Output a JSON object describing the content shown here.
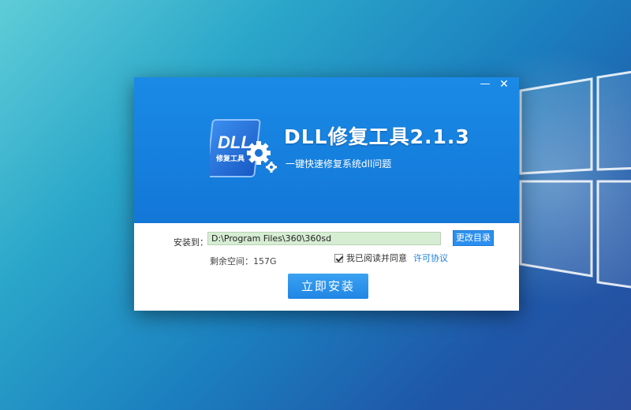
{
  "window": {
    "minimize_glyph": "—",
    "close_glyph": "✕"
  },
  "hero": {
    "logo_text": "DLL",
    "logo_subtext": "修复工具",
    "title": "DLL修复工具2.1.3",
    "subtitle": "一键快速修复系统dll问题"
  },
  "install": {
    "path_label": "安装到：",
    "path_value": "D:\\Program Files\\360\\360sd",
    "browse_label": "更改目录",
    "space_label": "剩余空间：157G",
    "agree_checked": true,
    "agree_text": "我已阅读并同意",
    "license_link": "许可协议",
    "install_button": "立即安装"
  },
  "icons": {
    "desktop_logo": "windows-logo-icon",
    "app_logo": "dll-gear-icon",
    "minimize": "minimize-icon",
    "close": "close-icon",
    "checkbox": "checkbox-checked-icon"
  },
  "colors": {
    "hero_blue": "#1377d8",
    "button_blue": "#2b8ff0",
    "path_bg": "#d6edd3",
    "link_blue": "#1a7fe0"
  }
}
